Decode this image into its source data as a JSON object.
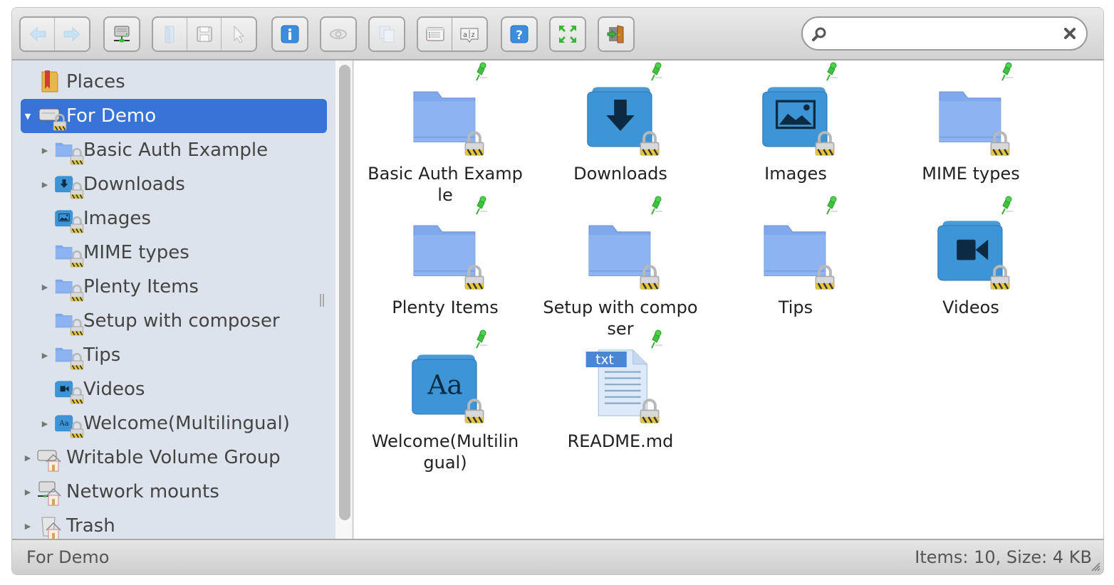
{
  "toolbar": {
    "groups": [
      [
        {
          "name": "back-button",
          "icon": "arrow-left-icon",
          "enabled": false
        },
        {
          "name": "forward-button",
          "icon": "arrow-right-icon",
          "enabled": false
        }
      ],
      [
        {
          "name": "netmount-button",
          "icon": "network-drive-icon",
          "enabled": true
        }
      ],
      [
        {
          "name": "open-button",
          "icon": "open-folder-icon",
          "enabled": false
        },
        {
          "name": "download-button",
          "icon": "save-icon",
          "enabled": false
        },
        {
          "name": "select-button",
          "icon": "cursor-icon",
          "enabled": false
        }
      ],
      [
        {
          "name": "info-button",
          "icon": "info-icon",
          "enabled": true
        }
      ],
      [
        {
          "name": "quicklook-button",
          "icon": "eye-icon",
          "enabled": false
        }
      ],
      [
        {
          "name": "copy-button",
          "icon": "copy-icon",
          "enabled": false
        }
      ],
      [
        {
          "name": "view-button",
          "icon": "list-view-icon",
          "enabled": true
        },
        {
          "name": "sort-button",
          "icon": "sort-az-icon",
          "enabled": true
        }
      ],
      [
        {
          "name": "help-button",
          "icon": "help-icon",
          "enabled": true
        }
      ],
      [
        {
          "name": "fullscreen-button",
          "icon": "fullscreen-icon",
          "enabled": true
        }
      ],
      [
        {
          "name": "exit-button",
          "icon": "exit-door-icon",
          "enabled": true
        }
      ]
    ],
    "search": {
      "value": "",
      "placeholder": ""
    }
  },
  "sidebar": {
    "items": [
      {
        "label": "Places",
        "level": 0,
        "arrow": "",
        "icon": "places-icon",
        "selected": false
      },
      {
        "label": "For Demo",
        "level": 0,
        "arrow": "expanded",
        "icon": "drive-locked-icon",
        "selected": true
      },
      {
        "label": "Basic Auth Example",
        "level": 1,
        "arrow": "collapsed",
        "icon": "folder-locked-icon",
        "selected": false
      },
      {
        "label": "Downloads",
        "level": 1,
        "arrow": "collapsed",
        "icon": "downloads-folder-icon",
        "selected": false
      },
      {
        "label": "Images",
        "level": 1,
        "arrow": "",
        "icon": "images-folder-icon",
        "selected": false
      },
      {
        "label": "MIME types",
        "level": 1,
        "arrow": "",
        "icon": "folder-locked-icon",
        "selected": false
      },
      {
        "label": "Plenty Items",
        "level": 1,
        "arrow": "collapsed",
        "icon": "folder-locked-icon",
        "selected": false
      },
      {
        "label": "Setup with composer",
        "level": 1,
        "arrow": "",
        "icon": "folder-locked-icon",
        "selected": false
      },
      {
        "label": "Tips",
        "level": 1,
        "arrow": "collapsed",
        "icon": "folder-locked-icon",
        "selected": false
      },
      {
        "label": "Videos",
        "level": 1,
        "arrow": "",
        "icon": "videos-folder-icon",
        "selected": false
      },
      {
        "label": "Welcome(Multilingual)",
        "level": 1,
        "arrow": "collapsed",
        "icon": "fonts-folder-icon",
        "selected": false
      },
      {
        "label": "Writable Volume Group",
        "level": 0,
        "arrow": "collapsed",
        "icon": "drive-home-icon",
        "selected": false
      },
      {
        "label": "Network mounts",
        "level": 0,
        "arrow": "collapsed",
        "icon": "network-home-icon",
        "selected": false
      },
      {
        "label": "Trash",
        "level": 0,
        "arrow": "collapsed",
        "icon": "trash-home-icon",
        "selected": false
      }
    ]
  },
  "files": [
    {
      "name": "Basic Auth Example",
      "icon": "folder-icon"
    },
    {
      "name": "Downloads",
      "icon": "downloads-folder-icon"
    },
    {
      "name": "Images",
      "icon": "images-folder-icon"
    },
    {
      "name": "MIME types",
      "icon": "folder-icon"
    },
    {
      "name": "Plenty Items",
      "icon": "folder-icon"
    },
    {
      "name": "Setup with composer",
      "icon": "folder-icon"
    },
    {
      "name": "Tips",
      "icon": "folder-icon"
    },
    {
      "name": "Videos",
      "icon": "videos-folder-icon"
    },
    {
      "name": "Welcome(Multilingual)",
      "icon": "fonts-folder-icon"
    },
    {
      "name": "README.md",
      "icon": "text-file-icon",
      "badge": "txt"
    }
  ],
  "status": {
    "path": "For Demo",
    "summary": "Items: 10, Size: 4 KB"
  },
  "colors": {
    "selection": "#3874d8",
    "sidebar_bg": "#dde3ec",
    "folder_blue": "#7ea8ec",
    "special_folder_blue": "#3e95d6",
    "pin_green": "#3cc43c"
  }
}
